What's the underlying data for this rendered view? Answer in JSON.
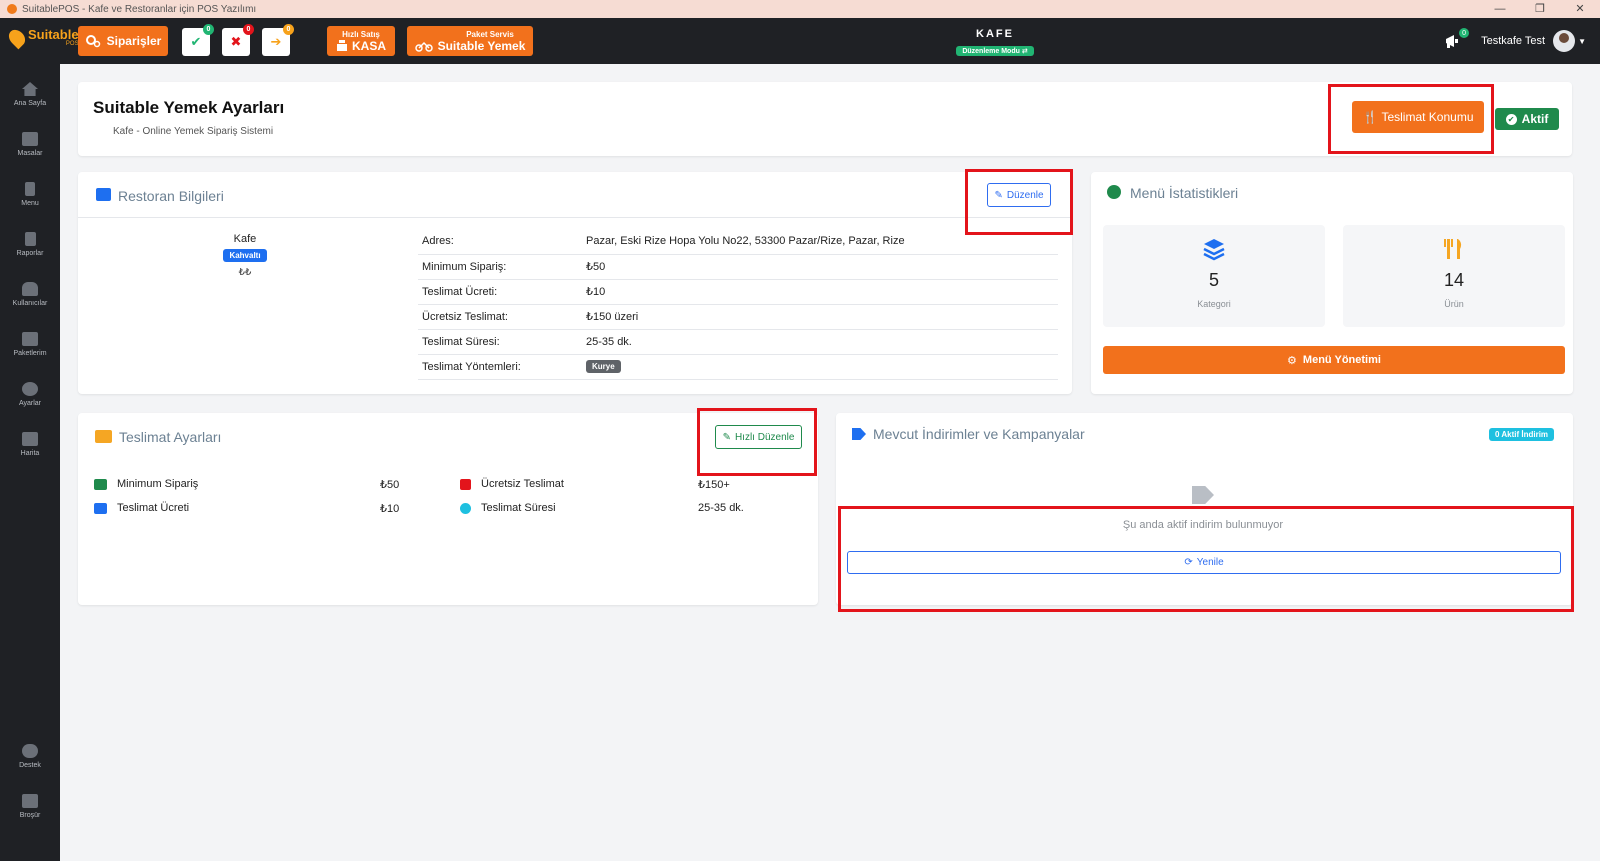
{
  "window": {
    "title": "SuitablePOS - Kafe ve Restoranlar için POS Yazılımı",
    "controls": [
      "—",
      "❐",
      "✕"
    ]
  },
  "topnav": {
    "logo_text": "Suitable",
    "logo_sub": "POS",
    "orders_label": "Siparişler",
    "status_buttons": [
      {
        "symbol": "✔",
        "badge": "0",
        "color": "#21b573"
      },
      {
        "symbol": "✖",
        "badge": "0",
        "color": "#e3141b"
      },
      {
        "symbol": "➔",
        "badge": "0",
        "color": "#f7a21b"
      }
    ],
    "quick_sale_caption": "Hızlı Satış",
    "kasa_label": "KASA",
    "package_caption": "Paket Servis",
    "suitable_yemek_label": "Suitable Yemek",
    "branch_name": "KAFE",
    "edit_mode_label": "Düzenleme Modu",
    "notification_badge": "0",
    "user_name": "Testkafe Test"
  },
  "sidebar": {
    "items": [
      {
        "label": "Ana Sayfa",
        "icon": "home-icon"
      },
      {
        "label": "Masalar",
        "icon": "table-icon"
      },
      {
        "label": "Menu",
        "icon": "utensils-icon"
      },
      {
        "label": "Raporlar",
        "icon": "report-icon"
      },
      {
        "label": "Kullanıcılar",
        "icon": "users-icon"
      },
      {
        "label": "Paketlerim",
        "icon": "gift-icon"
      },
      {
        "label": "Ayarlar",
        "icon": "gears-icon"
      },
      {
        "label": "Harita",
        "icon": "map-icon"
      }
    ],
    "bottom_items": [
      {
        "label": "Destek",
        "icon": "chat-icon"
      },
      {
        "label": "Broşür",
        "icon": "brochure-icon"
      }
    ]
  },
  "header": {
    "title": "Suitable Yemek Ayarları",
    "subtitle": "Kafe - Online Yemek Sipariş Sistemi",
    "delivery_location_label": "Teslimat Konumu",
    "status_label": "Aktif"
  },
  "restaurant": {
    "title": "Restoran Bilgileri",
    "edit_label": "Düzenle",
    "name": "Kafe",
    "category": "Kahvaltı",
    "price_level": "₺₺",
    "rows": [
      {
        "key": "Adres:",
        "value": "Pazar, Eski Rize Hopa Yolu No22, 53300 Pazar/Rize, Pazar, Rize"
      },
      {
        "key": "Minimum Sipariş:",
        "value": "₺50"
      },
      {
        "key": "Teslimat Ücreti:",
        "value": "₺10"
      },
      {
        "key": "Ücretsiz Teslimat:",
        "value": "₺150 üzeri"
      },
      {
        "key": "Teslimat Süresi:",
        "value": "25-35 dk."
      },
      {
        "key": "Teslimat Yöntemleri:",
        "value": "Kurye"
      }
    ]
  },
  "menu_stats": {
    "title": "Menü İstatistikleri",
    "category_count": "5",
    "category_label": "Kategori",
    "product_count": "14",
    "product_label": "Ürün",
    "manage_label": "Menü Yönetimi"
  },
  "delivery_settings": {
    "title": "Teslimat Ayarları",
    "quick_edit_label": "Hızlı Düzenle",
    "min_order_label": "Minimum Sipariş",
    "min_order_value": "₺50",
    "fee_label": "Teslimat Ücreti",
    "fee_value": "₺10",
    "free_label": "Ücretsiz Teslimat",
    "free_value": "₺150+",
    "time_label": "Teslimat Süresi",
    "time_value": "25-35 dk."
  },
  "discounts": {
    "title": "Mevcut İndirimler ve Kampanyalar",
    "badge": "0 Aktif İndirim",
    "empty_text": "Şu anda aktif indirim bulunmuyor",
    "refresh_label": "Yenile"
  },
  "colors": {
    "accent": "#f2711c",
    "success": "#1f8a4c",
    "primary": "#2f6df0",
    "highlight": "#e3141b"
  }
}
